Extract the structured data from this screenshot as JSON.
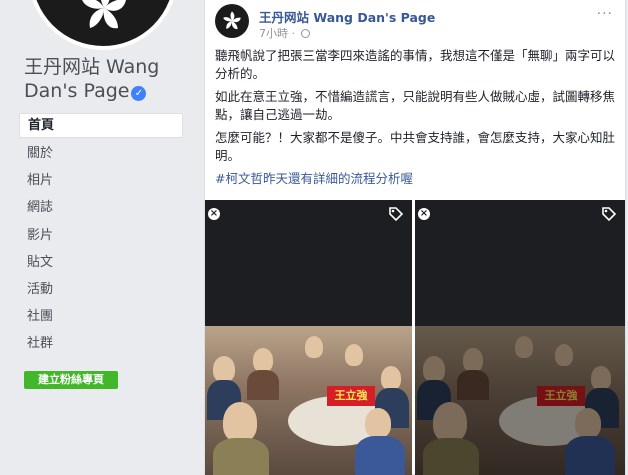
{
  "sidebar": {
    "page_name": "王丹网站 Wang Dan's Page",
    "nav_items": [
      {
        "label": "首頁",
        "active": true
      },
      {
        "label": "關於"
      },
      {
        "label": "相片"
      },
      {
        "label": "網誌"
      },
      {
        "label": "影片"
      },
      {
        "label": "貼文"
      },
      {
        "label": "活動"
      },
      {
        "label": "社團"
      },
      {
        "label": "社群"
      }
    ],
    "create_button": "建立粉絲專頁"
  },
  "post": {
    "author": "王丹网站 Wang Dan's Page",
    "time": "7小時 · ",
    "more": "···",
    "paragraphs": [
      "聽飛帆說了把張三當李四來造謠的事情，我想這不僅是「無聊」兩字可以分析的。",
      "如此在意王立強，不惜編造謊言，只能說明有些人做賊心虛，試圖轉移焦點，讓自己逃過一劫。",
      "怎麼可能？！大家都不是傻子。中共會支持誰，會怎麼支持，大家心知肚明。"
    ],
    "hashtag": "#柯文哲昨天還有詳細的流程分析喔",
    "photo_label": "王立強",
    "photo_close": "×"
  },
  "colors": {
    "link": "#385898",
    "green_button": "#42b72a",
    "verified": "#4080ff",
    "background": "#e9ebee"
  }
}
